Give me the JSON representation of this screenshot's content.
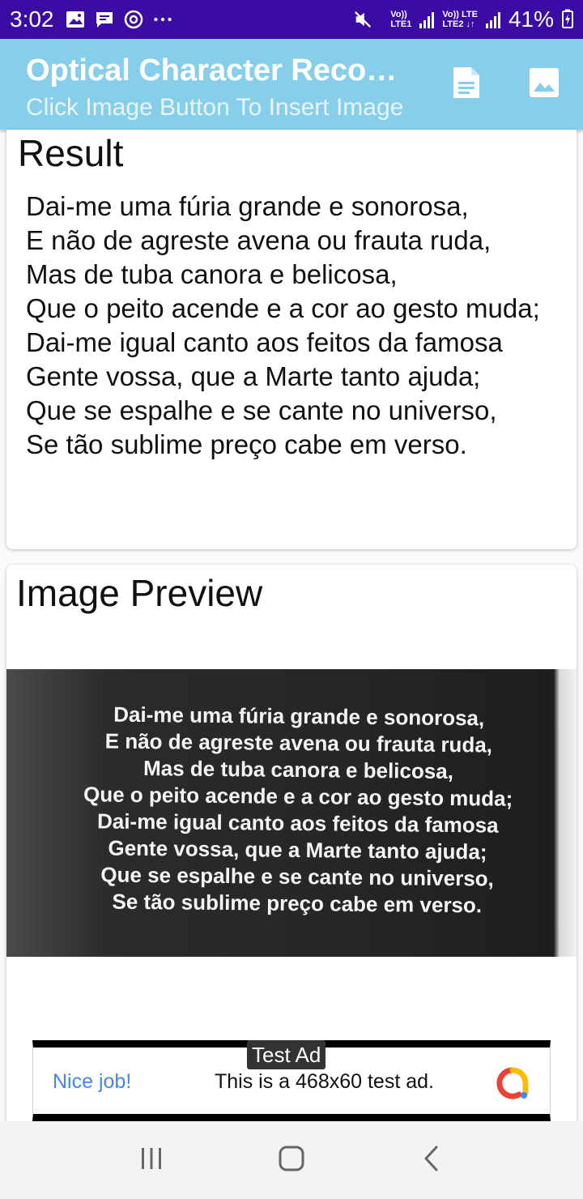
{
  "status_bar": {
    "time": "3:02",
    "sim1_top": "Vo))",
    "sim1_bottom": "LTE1",
    "sim2_top": "Vo)) LTE",
    "sim2_bottom": "LTE2 ↓↑",
    "battery": "41%"
  },
  "app_bar": {
    "title": "Optical Character Recognition",
    "subtitle": "Click Image Button To Insert Image"
  },
  "result": {
    "heading": "Result",
    "text": "Dai-me uma fúria grande e sonorosa,\nE não de agreste avena ou frauta ruda,\nMas de tuba canora e belicosa,\nQue o peito acende e a cor ao gesto muda;\nDai-me igual canto aos feitos da famosa\nGente vossa, que a Marte tanto ajuda;\nQue se espalhe e se cante no universo,\nSe tão sublime preço cabe em verso."
  },
  "preview": {
    "heading": "Image Preview",
    "photo_text": "Dai-me uma fúria grande e sonorosa,\nE não de agreste avena ou frauta ruda,\nMas de tuba canora e belicosa,\nQue o peito acende e a cor ao gesto muda;\nDai-me igual canto aos feitos da famosa\nGente vossa, que a Marte tanto ajuda;\nQue se espalhe e se cante no universo,\nSe tão sublime preço cabe em verso."
  },
  "ad": {
    "badge": "Test Ad",
    "headline": "Nice job!",
    "body": "This is a 468x60 test ad."
  },
  "colors": {
    "status_bar": "#3a0ca3",
    "app_bar": "#87ceeb",
    "ad_headline": "#4285f4"
  },
  "icons": {
    "document_button": "document-icon",
    "image_button": "image-icon",
    "nav_recent": "recent-apps-icon",
    "nav_home": "home-icon",
    "nav_back": "back-icon"
  }
}
